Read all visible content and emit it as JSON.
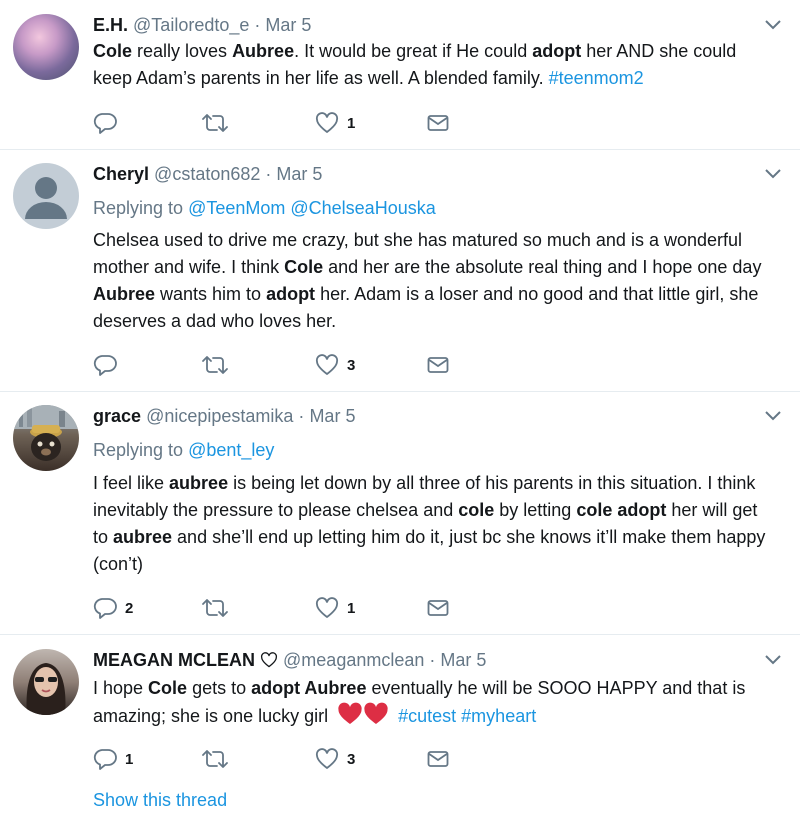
{
  "tweets": [
    {
      "name": "E.H.",
      "handle": "@Tailoredto_e",
      "date": "Mar 5",
      "text_html": "<b>Cole</b> really loves <b>Aubree</b>. It would be great if He could <b>adopt</b> her AND she could keep Adam’s parents in her life as well. A blended family. <span class=\"hashtag\">#teenmom2</span>",
      "reply_count": "",
      "like_count": "1"
    },
    {
      "name": "Cheryl",
      "handle": "@cstaton682",
      "date": "Mar 5",
      "replying_label": "Replying to",
      "replying_to": "@TeenMom @ChelseaHouska",
      "text_html": "Chelsea used to drive me crazy, but she has matured so much and is a wonderful mother and wife. I think <b>Cole</b> and her are the absolute real thing and I hope one day <b>Aubree</b> wants him to <b>adopt</b> her. Adam is a loser and no good and that little girl, she deserves a dad who loves her.",
      "reply_count": "",
      "like_count": "3"
    },
    {
      "name": "grace",
      "handle": "@nicepipestamika",
      "date": "Mar 5",
      "replying_label": "Replying to",
      "replying_to": "@bent_ley",
      "text_html": "I feel like <b>aubree</b> is being let down by all three of his parents in this situation. I think inevitably the pressure to please chelsea and <b>cole</b> by letting <b>cole adopt</b> her will get to <b>aubree</b> and she’ll end up letting him do it, just bc she knows it’ll make them happy (con’t)",
      "reply_count": "2",
      "like_count": "1"
    },
    {
      "name": "MEAGAN MCLEAN",
      "handle": "@meaganmclean",
      "date": "Mar 5",
      "text_before": "I hope <b>Cole</b> gets to <b>adopt Aubree</b> eventually he will be SOOO HAPPY and that is amazing; she is one lucky girl",
      "hashtags": "#cutest #myheart",
      "reply_count": "1",
      "like_count": "3",
      "show_thread": "Show this thread"
    }
  ],
  "colors": {
    "link": "#1b95e0",
    "secondary": "#657786",
    "icon": "#657786",
    "separator": "#e6ecf0",
    "heart_emoji": "#dd2e44"
  },
  "icons": [
    "reply-icon",
    "retweet-icon",
    "like-icon",
    "dm-icon",
    "chevron-down-icon",
    "heart-emoji-icon"
  ]
}
